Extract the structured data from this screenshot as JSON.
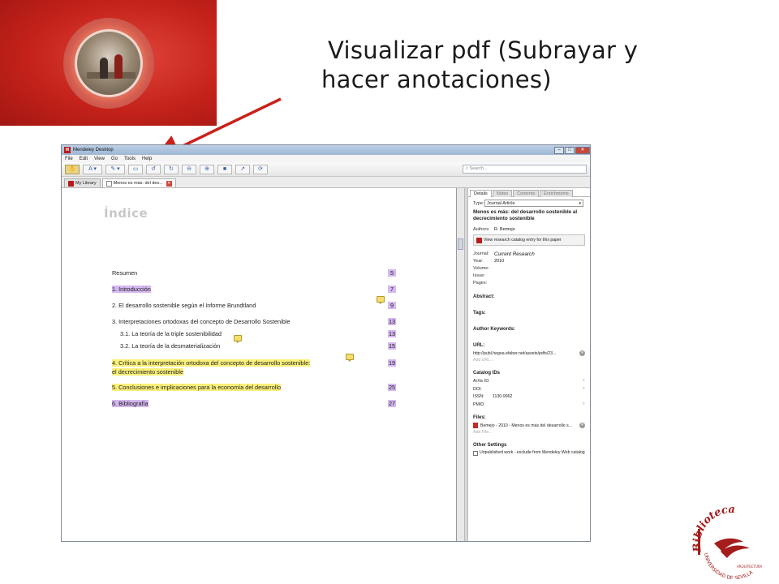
{
  "slide": {
    "title_line1": "Visualizar pdf (Subrayar y",
    "title_line2": "hacer anotaciones)"
  },
  "colors": {
    "red_block": "#c4221a",
    "arrow": "#c9211a",
    "highlight_purple": "#d5b8f0",
    "highlight_yellow": "#fbf07a",
    "logo_red": "#a51c1c"
  },
  "app": {
    "title": "Mendeley Desktop",
    "logo_letter": "M",
    "controls": {
      "minimize": "–",
      "maximize": "□",
      "close": "✕"
    },
    "menu": [
      "File",
      "Edit",
      "View",
      "Go",
      "Tools",
      "Help"
    ],
    "toolbar_icons": [
      "hand-icon",
      "text-select-icon",
      "highlight-icon",
      "note-icon",
      "rotate-left-icon",
      "rotate-right-icon",
      "zoom-out-icon",
      "zoom-in-icon",
      "fullscreen-icon",
      "share-icon",
      "sync-icon"
    ],
    "toolbar_glyphs": [
      "✋",
      "A ▾",
      "✎ ▾",
      "▭",
      "↺",
      "↻",
      "⊖",
      "⊕",
      "■",
      "↗",
      "⟳"
    ],
    "search_placeholder": "Search...",
    "search_glyph": "⌕",
    "tabs": [
      {
        "label": "My Library"
      },
      {
        "label": "Menos es más: del des..."
      }
    ],
    "tab_close": "✕"
  },
  "document": {
    "heading": "Índice",
    "toc": [
      {
        "text": "Resumen",
        "page": "5",
        "hl": "none"
      },
      {
        "text": "1. Introducción",
        "page": "7",
        "hl": "purple"
      },
      {
        "text": "2. El desarrollo sostenible según el Informe Brundtland",
        "page": "9",
        "hl": "none"
      },
      {
        "text": "3. Interpretaciones ortodoxas del concepto de Desarrollo Sostenible",
        "page": "13",
        "hl": "none"
      },
      {
        "text": "3.1. La teoría de la triple sostenibilidad",
        "page": "13",
        "hl": "none"
      },
      {
        "text": "3.2.  La teoría de la desmaterialización",
        "page": "15",
        "hl": "none"
      },
      {
        "text": "4. Crítica a la interpretación ortodoxa del concepto de desarrollo sostenible:",
        "text2": "el decrecimiento sostenible",
        "page": "19",
        "hl": "yellow"
      },
      {
        "text": "5. Conclusiones e implicaciones para la economía del desarrollo",
        "page": "25",
        "hl": "yellow"
      },
      {
        "text": "6. Bibliografía",
        "page": "27",
        "hl": "purple"
      }
    ]
  },
  "details": {
    "tabs": [
      "Details",
      "Notes",
      "Contents",
      "Enrichments"
    ],
    "type_label": "Type:",
    "type_value": "Journal Article",
    "select_arrow": "▾",
    "article_title": "Menos es más: del desarrollo sostenible al decrecimiento sostenible",
    "authors_label": "Authors:",
    "authors_value": "R. Bemejo",
    "catalog_button": "View research catalog entry for this paper",
    "journal_label": "Journal:",
    "journal_value": "Current Research",
    "year_label": "Year:",
    "year_value": "2010",
    "volume_label": "Volume:",
    "issue_label": "Issue:",
    "pages_label": "Pages:",
    "abstract_label": "Abstract:",
    "tags_label": "Tags:",
    "keywords_label": "Author Keywords:",
    "url_label": "URL:",
    "url_value": "http://publ.hegoa.efaber.net/assets/pdfs/23...",
    "add_url": "Add URL...",
    "catalog_ids_label": "Catalog IDs",
    "arxiv_label": "ArXiv ID:",
    "doi_label": "DOI:",
    "issn_label": "ISSN:",
    "issn_value": "1130-9962",
    "pmid_label": "PMID:",
    "files_label": "Files:",
    "file_value": "Bemejo - 2010 - Menos es más del desarrollo s...",
    "add_file": "Add File...",
    "other_settings_label": "Other Settings",
    "unpublished_label": "Unpublished work - exclude from Mendeley Web catalog",
    "clear_glyph": "✕",
    "lookup_glyph": "⌕"
  },
  "logo": {
    "text_top": "Biblioteca",
    "text_bottom": "UNIVERSIDAD DE SEVILLA",
    "text_side": "ARQUITECTURA"
  }
}
